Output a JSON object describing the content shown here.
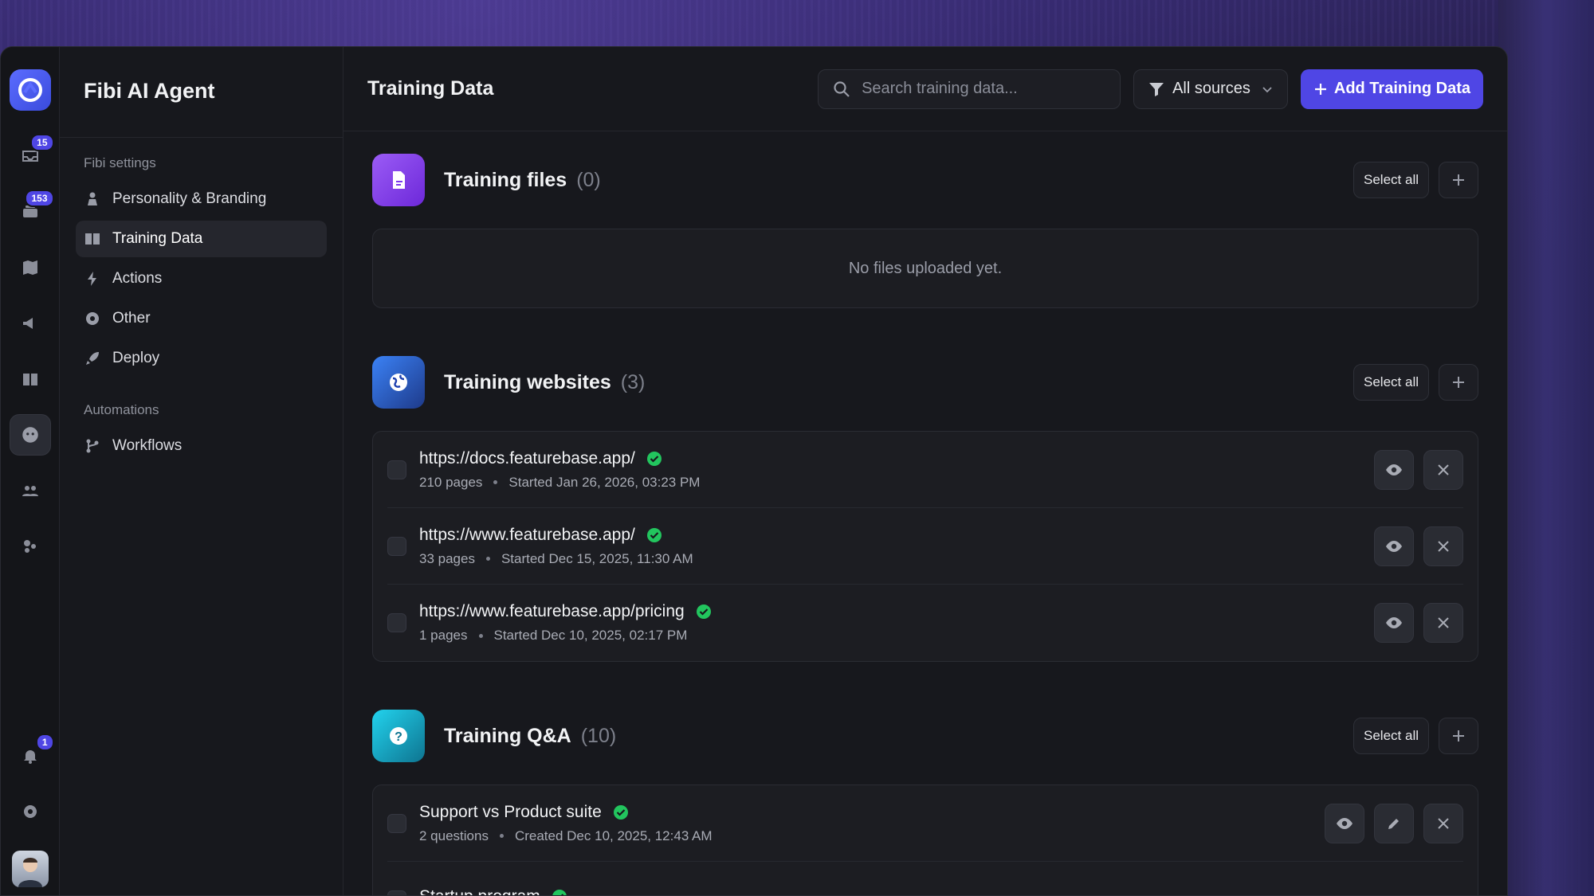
{
  "rail": {
    "badges": {
      "inbox": "15",
      "messages": "153",
      "notifications": "1"
    }
  },
  "sidebar": {
    "title": "Fibi AI Agent",
    "sections": [
      {
        "title": "Fibi settings",
        "items": [
          "Personality & Branding",
          "Training Data",
          "Actions",
          "Other",
          "Deploy"
        ]
      },
      {
        "title": "Automations",
        "items": [
          "Workflows"
        ]
      }
    ],
    "active_item": "Training Data"
  },
  "topbar": {
    "title": "Training Data",
    "search_placeholder": "Search training data...",
    "filter_label": "All sources",
    "add_label": "Add Training Data"
  },
  "files": {
    "title": "Training files",
    "count": "(0)",
    "select_all": "Select all",
    "empty": "No files uploaded yet."
  },
  "websites": {
    "title": "Training websites",
    "count": "(3)",
    "select_all": "Select all",
    "rows": [
      {
        "url": "https://docs.featurebase.app/",
        "pages": "210 pages",
        "started": "Started Jan 26, 2026, 03:23 PM"
      },
      {
        "url": "https://www.featurebase.app/",
        "pages": "33 pages",
        "started": "Started Dec 15, 2025, 11:30 AM"
      },
      {
        "url": "https://www.featurebase.app/pricing",
        "pages": "1 pages",
        "started": "Started Dec 10, 2025, 02:17 PM"
      }
    ]
  },
  "qa": {
    "title": "Training Q&A",
    "count": "(10)",
    "select_all": "Select all",
    "rows": [
      {
        "title": "Support vs Product suite",
        "questions": "2 questions",
        "created": "Created Dec 10, 2025, 12:43 AM"
      },
      {
        "title": "Startup program",
        "questions": "",
        "created": ""
      }
    ]
  },
  "colors": {
    "accent": "#4f46e5",
    "success": "#22c55e"
  }
}
